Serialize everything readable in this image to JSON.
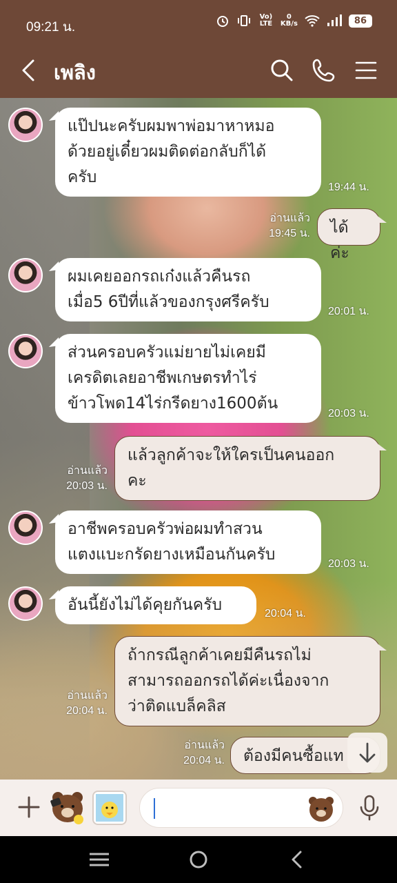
{
  "status_bar": {
    "time": "09:21 น.",
    "net_label": "Vo) LTE",
    "net_speed_value": "0",
    "net_speed_unit": "KB/s",
    "battery": "86"
  },
  "header": {
    "title": "เพลิง",
    "icons": [
      "back-icon",
      "search-icon",
      "phone-icon",
      "menu-icon"
    ]
  },
  "messages": [
    {
      "side": "in",
      "text_lines": [
        "แป๊ปนะครับผมพาพ่อมาหาหมอ",
        "ด้วยอยู่เดี๋ยวผมติดต่อกลับก็ได้",
        "ครับ"
      ],
      "time": "19:44 น."
    },
    {
      "side": "out",
      "text_lines": [
        "ได้ค่ะ"
      ],
      "read": "อ่านแล้ว",
      "time": "19:45 น."
    },
    {
      "side": "in",
      "text_lines": [
        "ผมเคยออกรถเก๋งแล้วคืนรถ",
        "เมื่อ5 6ปีที่แล้วของกรุงศรีครับ"
      ],
      "time": "20:01 น."
    },
    {
      "side": "in",
      "text_lines": [
        "ส่วนครอบครัวแม่ยายไม่เคยมี",
        "เครดิตเลยอาชีพเกษตรทำไร่",
        "ข้าวโพด14ไร่กรีดยาง1600ต้น"
      ],
      "time": "20:03 น."
    },
    {
      "side": "out",
      "text_lines": [
        "แล้วลูกค้าจะให้ใครเป็นคนออก",
        "คะ"
      ],
      "read": "อ่านแล้ว",
      "time": "20:03 น."
    },
    {
      "side": "in",
      "text_lines": [
        "อาชีพครอบครัวพ่อผมทำสวน",
        "แตงแบะกรัดยางเหมือนกันครับ"
      ],
      "time": "20:03 น."
    },
    {
      "side": "in",
      "text_lines": [
        "อันนี้ยังไม่ได้คุยกันครับ"
      ],
      "time": "20:04 น."
    },
    {
      "side": "out",
      "text_lines": [
        "ถ้ากรณีลูกค้าเคยมีคืนรถไม่",
        "สามารถออกรถได้ค่ะเนื่องจาก",
        "ว่าติดแบล็คลิส"
      ],
      "read": "อ่านแล้ว",
      "time": "20:04 น."
    },
    {
      "side": "out",
      "text_lines": [
        "ต้องมีคนซื้อแท"
      ],
      "read": "อ่านแล้ว",
      "time": "20:04 น."
    }
  ],
  "input_bar": {
    "placeholder": "",
    "icons": [
      "plus-icon",
      "brown-bear-sticker-icon",
      "sally-sticker-icon",
      "emoji-bear-icon",
      "mic-icon"
    ]
  },
  "nav_bar": {
    "icons": [
      "recent-apps-icon",
      "home-icon",
      "back-nav-icon"
    ]
  },
  "colors": {
    "header": "#6e4837",
    "outgoing_bubble": "#f1e9e4",
    "incoming_bubble": "#ffffff",
    "input_bar": "#f5efec"
  }
}
